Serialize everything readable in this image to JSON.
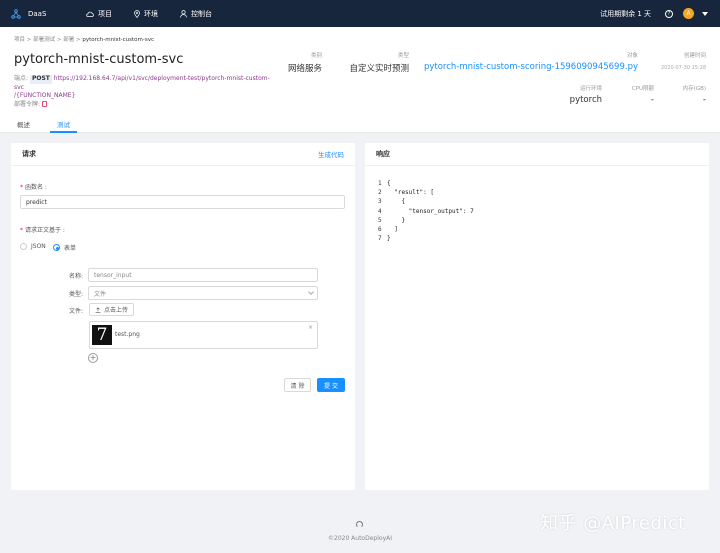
{
  "topbar": {
    "app_name": "DaaS",
    "nav": [
      {
        "label": "项目",
        "icon": "cloud-icon"
      },
      {
        "label": "环境",
        "icon": "location-icon"
      },
      {
        "label": "控制台",
        "icon": "user-icon"
      }
    ],
    "trial_text": "试用期剩余 1 天",
    "help_glyph": "?",
    "avatar_text": "A"
  },
  "breadcrumb": [
    "项目",
    "部署测试",
    "部署",
    "pytorch-mnist-custom-svc"
  ],
  "deployment": {
    "title": "pytorch-mnist-custom-svc",
    "endpoint_label": "端点:",
    "method": "POST",
    "url": "https://192.168.64.7/api/v1/svc/deployment-test/pytorch-mnist-custom-svc",
    "url_suffix": "/{FUNCTION_NAME}",
    "token_label": "部署令牌:"
  },
  "meta": {
    "category_label": "类别",
    "category": "网络服务",
    "type_label": "类型",
    "type": "自定义实时预测",
    "object_label": "对象",
    "object": "pytorch-mnist-custom-scoring-1596090945699.py",
    "created_label": "创建时间",
    "created": "2020-07-30 15:28",
    "runtime_label": "运行环境",
    "runtime": "pytorch",
    "cpu_label": "CPU限额",
    "cpu": "-",
    "memory_label": "内存(GB)",
    "memory": "-"
  },
  "tabs": [
    "概述",
    "测试"
  ],
  "request": {
    "title": "请求",
    "generate_code": "生成代码",
    "function_label": "函数名",
    "function_value": "predict",
    "body_label": "请求正文基于",
    "body_options": [
      "JSON",
      "表单"
    ],
    "form": {
      "name_label": "名称:",
      "name_value": "tensor_input",
      "type_label": "类型:",
      "type_value": "文件",
      "file_label": "文件:",
      "upload_label": "点击上传",
      "file_name": "test.png",
      "thumb_digit": "7",
      "remove_glyph": "×",
      "add_glyph": "+"
    },
    "clear_label": "清 除",
    "submit_label": "提 交"
  },
  "response": {
    "title": "响应",
    "lines": [
      {
        "n": "1",
        "t": "{"
      },
      {
        "n": "2",
        "t": "  \"result\": ["
      },
      {
        "n": "3",
        "t": "    {"
      },
      {
        "n": "4",
        "t": "      \"tensor_output\": 7"
      },
      {
        "n": "5",
        "t": "    }"
      },
      {
        "n": "6",
        "t": "  ]"
      },
      {
        "n": "7",
        "t": "}"
      }
    ]
  },
  "footer": {
    "copyright": "©2020 AutoDeployAI"
  },
  "watermark": "知乎 @AIPredict"
}
